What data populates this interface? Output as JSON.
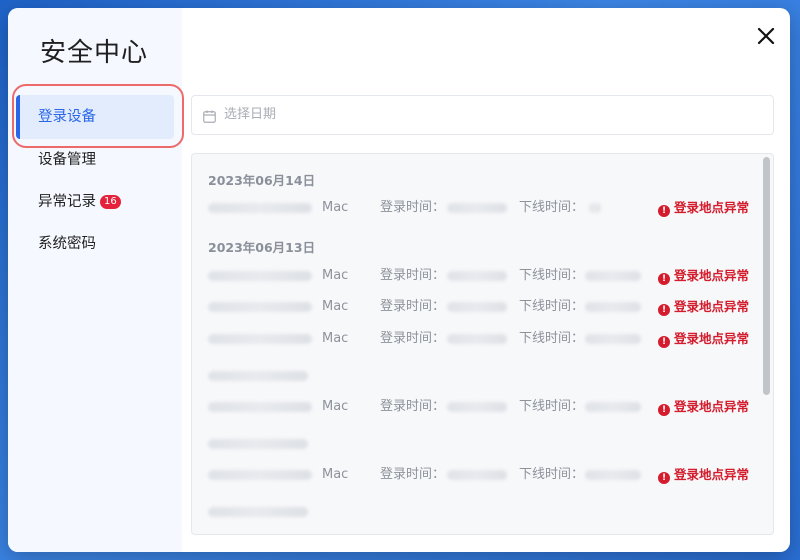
{
  "sidebar": {
    "title": "安全中心",
    "items": [
      {
        "label": "登录设备",
        "active": true
      },
      {
        "label": "设备管理"
      },
      {
        "label": "异常记录",
        "badge": "16"
      },
      {
        "label": "系统密码"
      }
    ]
  },
  "close_icon": "close-icon",
  "date_picker": {
    "placeholder": "选择日期",
    "icon": "calendar-icon"
  },
  "records": {
    "groups": [
      {
        "date": "2023年06月14日"
      },
      {
        "date": "2023年06月13日"
      }
    ],
    "rows": [
      {
        "os": "Mac",
        "login_label": "登录时间：",
        "logout_label": "下线时间：",
        "anomaly": "登录地点异常"
      },
      {
        "os": "Mac",
        "login_label": "登录时间：",
        "logout_label": "下线时间：",
        "anomaly": "登录地点异常"
      },
      {
        "os": "Mac",
        "login_label": "登录时间：",
        "logout_label": "下线时间：",
        "anomaly": "登录地点异常"
      },
      {
        "os": "Mac",
        "login_label": "登录时间：",
        "logout_label": "下线时间：",
        "anomaly": "登录地点异常"
      },
      {
        "os": "Mac",
        "login_label": "登录时间：",
        "logout_label": "下线时间：",
        "anomaly": "登录地点异常"
      },
      {
        "os": "Mac",
        "login_label": "登录时间：",
        "logout_label": "下线时间：",
        "anomaly": "登录地点异常"
      }
    ]
  },
  "colors": {
    "accent": "#2a67e8",
    "danger": "#d41c2c",
    "badge": "#e5223b"
  }
}
